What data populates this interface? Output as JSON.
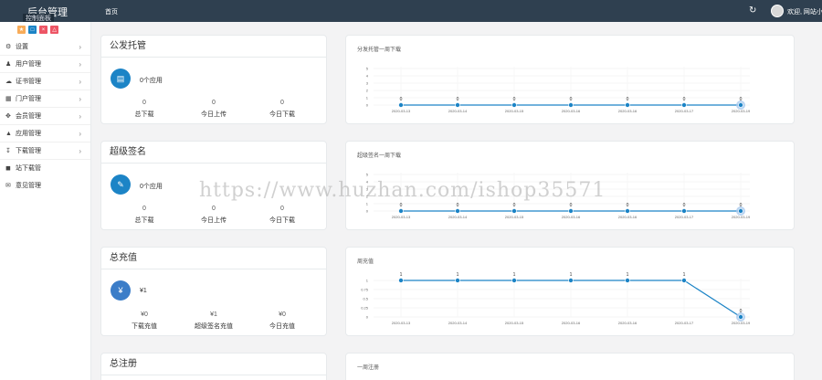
{
  "header": {
    "brand": "后台管理",
    "brand_sub": "控制面板",
    "nav_home": "首页",
    "welcome": "欢迎, 网站小编",
    "refresh_icon": "refresh-icon",
    "bg_color": "#2f4050"
  },
  "sidebar": {
    "quick_buttons": [
      {
        "icon": "star-icon",
        "color": "#f8ac59"
      },
      {
        "icon": "file-icon",
        "color": "#1c84c6"
      },
      {
        "icon": "trash-icon",
        "color": "#ed5565"
      },
      {
        "icon": "bell-icon",
        "color": "#ed5565"
      }
    ],
    "items": [
      {
        "label": "设置",
        "icon": "gear-icon",
        "has_arrow": true
      },
      {
        "label": "用户管理",
        "icon": "users-icon",
        "has_arrow": true
      },
      {
        "label": "证书管理",
        "icon": "cloud-icon",
        "has_arrow": true
      },
      {
        "label": "门户管理",
        "icon": "window-icon",
        "has_arrow": true
      },
      {
        "label": "会员管理",
        "icon": "move-icon",
        "has_arrow": true
      },
      {
        "label": "应用管理",
        "icon": "android-icon",
        "has_arrow": true
      },
      {
        "label": "下载管理",
        "icon": "download-icon",
        "has_arrow": true
      },
      {
        "label": "站下载管",
        "icon": "cube-icon",
        "has_arrow": false
      },
      {
        "label": "意见管理",
        "icon": "mail-icon",
        "has_arrow": false
      }
    ]
  },
  "panels": {
    "app": {
      "title": "公发托管",
      "desc": "0个应用",
      "stats": [
        {
          "value": "0",
          "label": "总下载"
        },
        {
          "value": "0",
          "label": "今日上传"
        },
        {
          "value": "0",
          "label": "今日下载"
        }
      ]
    },
    "super": {
      "title": "超级签名",
      "desc": "0个应用",
      "stats": [
        {
          "value": "0",
          "label": "总下载"
        },
        {
          "value": "0",
          "label": "今日上传"
        },
        {
          "value": "0",
          "label": "今日下载"
        }
      ]
    },
    "recharge": {
      "title": "总充值",
      "desc": "¥1",
      "stats": [
        {
          "value": "¥0",
          "label": "下载充值"
        },
        {
          "value": "¥1",
          "label": "超级签名充值"
        },
        {
          "value": "¥0",
          "label": "今日充值"
        }
      ]
    },
    "register": {
      "title": "总注册"
    }
  },
  "watermark": "https://www.huzhan.com/ishop35571",
  "chart_data": [
    {
      "type": "line",
      "title": "分发托管一周下载",
      "x": [
        "2020-03-13",
        "2020-03-14",
        "2020-03-15",
        "2020-03-16",
        "2020-03-16",
        "2020-03-17",
        "2020-03-19"
      ],
      "series": [
        {
          "values": [
            0,
            0,
            0,
            0,
            0,
            0,
            0
          ]
        }
      ],
      "y_ticks": [
        "0",
        "1",
        "2",
        "3",
        "4",
        "5"
      ],
      "ylim": [
        0,
        5
      ],
      "color": "#1c84c6"
    },
    {
      "type": "line",
      "title": "超级签名一周下载",
      "x": [
        "2020-03-13",
        "2020-03-14",
        "2020-03-15",
        "2020-03-16",
        "2020-03-16",
        "2020-03-17",
        "2020-03-19"
      ],
      "series": [
        {
          "values": [
            0,
            0,
            0,
            0,
            0,
            0,
            0
          ]
        }
      ],
      "y_ticks": [
        "0",
        "1",
        "2",
        "3",
        "4",
        "5"
      ],
      "ylim": [
        0,
        5
      ],
      "color": "#1c84c6"
    },
    {
      "type": "line",
      "title": "周充值",
      "x": [
        "2020-03-13",
        "2020-03-14",
        "2020-03-15",
        "2020-03-16",
        "2020-03-16",
        "2020-03-17",
        "2020-03-19"
      ],
      "series": [
        {
          "values": [
            1,
            1,
            1,
            1,
            1,
            1,
            0
          ]
        }
      ],
      "y_ticks": [
        "0",
        "0.25",
        "0.5",
        "0.75",
        "1"
      ],
      "ylim": [
        0,
        1
      ],
      "color": "#1c84c6"
    },
    {
      "type": "line",
      "title": "一周注册",
      "x": [],
      "series": [
        {
          "values": []
        }
      ],
      "y_ticks": [],
      "ylim": [
        0,
        1
      ],
      "color": "#1c84c6"
    }
  ]
}
